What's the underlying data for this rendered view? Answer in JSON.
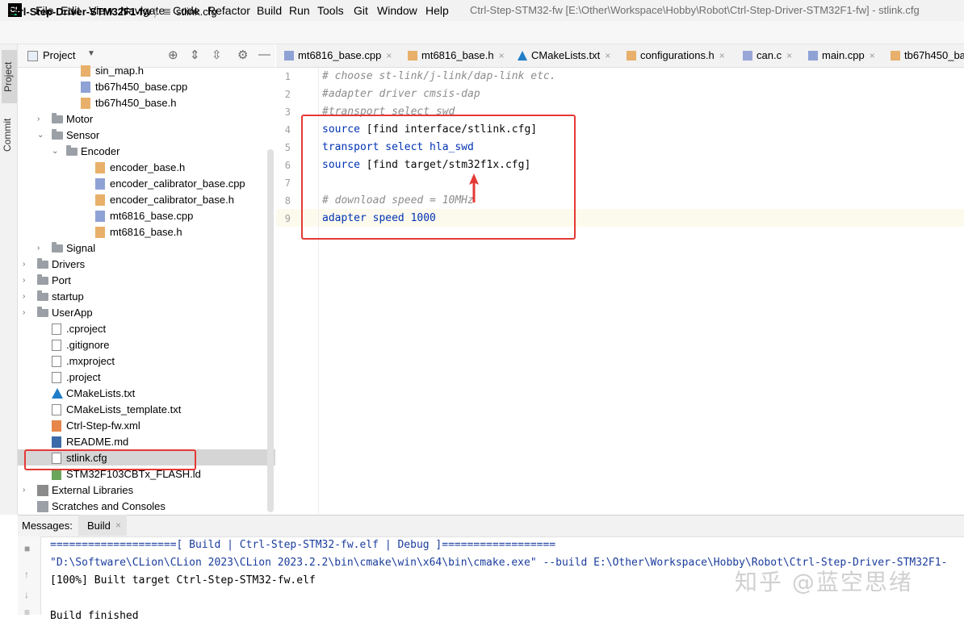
{
  "menubar": {
    "logo": "CL",
    "items": [
      "File",
      "Edit",
      "View",
      "Navigate",
      "Code",
      "Refactor",
      "Build",
      "Run",
      "Tools",
      "Git",
      "Window",
      "Help"
    ],
    "window_title": "Ctrl-Step-STM32-fw [E:\\Other\\Workspace\\Hobby\\Robot\\Ctrl-Step-Driver-STM32F1-fw] - stlink.cfg"
  },
  "breadcrumb": {
    "project": "Ctrl-Step-Driver-STM32F1-fw",
    "separator": "〉",
    "file_icon": "≣",
    "file": "stlink.cfg"
  },
  "left_strip": {
    "project_tab": "Project",
    "commit_tab": "Commit"
  },
  "project_panel": {
    "title": "Project",
    "dropdown": "▼",
    "icons": [
      "target-icon",
      "expand-all-icon",
      "collapse-all-icon",
      "gear-icon",
      "minimize-icon"
    ],
    "tree": [
      {
        "label": "sin_map.h",
        "kind": "h"
      },
      {
        "label": "tb67h450_base.cpp",
        "kind": "cpp"
      },
      {
        "label": "tb67h450_base.h",
        "kind": "h"
      },
      {
        "label": "Motor",
        "kind": "folder",
        "arrow": "›"
      },
      {
        "label": "Sensor",
        "kind": "folder",
        "arrow": "⌄"
      },
      {
        "label": "Encoder",
        "kind": "folder",
        "arrow": "⌄"
      },
      {
        "label": "encoder_base.h",
        "kind": "h"
      },
      {
        "label": "encoder_calibrator_base.cpp",
        "kind": "cpp"
      },
      {
        "label": "encoder_calibrator_base.h",
        "kind": "h"
      },
      {
        "label": "mt6816_base.cpp",
        "kind": "cpp"
      },
      {
        "label": "mt6816_base.h",
        "kind": "h"
      },
      {
        "label": "Signal",
        "kind": "folder",
        "arrow": "›"
      },
      {
        "label": "Drivers",
        "kind": "folder",
        "arrow": "›"
      },
      {
        "label": "Port",
        "kind": "folder",
        "arrow": "›"
      },
      {
        "label": "startup",
        "kind": "folder",
        "arrow": "›"
      },
      {
        "label": "UserApp",
        "kind": "folder",
        "arrow": "›"
      },
      {
        "label": ".cproject",
        "kind": "txt"
      },
      {
        "label": ".gitignore",
        "kind": "txt"
      },
      {
        "label": ".mxproject",
        "kind": "txt"
      },
      {
        "label": ".project",
        "kind": "txt"
      },
      {
        "label": "CMakeLists.txt",
        "kind": "cmake"
      },
      {
        "label": "CMakeLists_template.txt",
        "kind": "txt"
      },
      {
        "label": "Ctrl-Step-fw.xml",
        "kind": "xml"
      },
      {
        "label": "README.md",
        "kind": "md"
      },
      {
        "label": "stlink.cfg",
        "kind": "txt"
      },
      {
        "label": "STM32F103CBTx_FLASH.ld",
        "kind": "ld"
      },
      {
        "label": "External Libraries",
        "kind": "lib",
        "arrow": "›"
      },
      {
        "label": "Scratches and Consoles",
        "kind": "scr"
      }
    ],
    "selected": "stlink.cfg"
  },
  "tabs": [
    {
      "label": "mt6816_base.cpp",
      "kind": "cpp"
    },
    {
      "label": "mt6816_base.h",
      "kind": "h"
    },
    {
      "label": "CMakeLists.txt",
      "kind": "cmake"
    },
    {
      "label": "configurations.h",
      "kind": "h"
    },
    {
      "label": "can.c",
      "kind": "c"
    },
    {
      "label": "main.cpp",
      "kind": "cpp"
    },
    {
      "label": "tb67h450_ba",
      "kind": "h"
    }
  ],
  "editor": {
    "line_numbers": [
      "1",
      "2",
      "3",
      "4",
      "5",
      "6",
      "7",
      "8",
      "9"
    ],
    "lines": [
      {
        "type": "comment",
        "text": "# choose st-link/j-link/dap-link etc."
      },
      {
        "type": "comment",
        "text": "#adapter driver cmsis-dap"
      },
      {
        "type": "comment",
        "text": "#transport select swd"
      },
      {
        "type": "code",
        "kw": "source",
        "rest": " [find interface/stlink.cfg]"
      },
      {
        "type": "code",
        "kw": "transport select hla_swd",
        "rest": ""
      },
      {
        "type": "code",
        "kw": "source",
        "rest": " [find target/stm32f1x.cfg]"
      },
      {
        "type": "blank",
        "text": ""
      },
      {
        "type": "comment",
        "text": "# download speed = 10MHz"
      },
      {
        "type": "code",
        "kw": "adapter speed 1000",
        "rest": ""
      }
    ]
  },
  "bottom_panel": {
    "messages_label": "Messages:",
    "build_tab": "Build",
    "close": "×",
    "output": [
      {
        "style": "blue",
        "text": "====================[ Build | Ctrl-Step-STM32-fw.elf | Debug ]=================="
      },
      {
        "style": "blue",
        "text": "\"D:\\Software\\CLion\\CLion 2023\\CLion 2023.2.2\\bin\\cmake\\win\\x64\\bin\\cmake.exe\" --build E:\\Other\\Workspace\\Hobby\\Robot\\Ctrl-Step-Driver-STM32F1-"
      },
      {
        "style": "black",
        "text": "[100%] Built target Ctrl-Step-STM32-fw.elf"
      },
      {
        "style": "black",
        "text": ""
      },
      {
        "style": "black",
        "text": "Build finished"
      }
    ]
  },
  "watermark": "知乎 @蓝空思绪",
  "colors": {
    "annotation_red": "#e53935",
    "keyword_blue": "#0033b3",
    "comment_gray": "#8c8c8c"
  }
}
